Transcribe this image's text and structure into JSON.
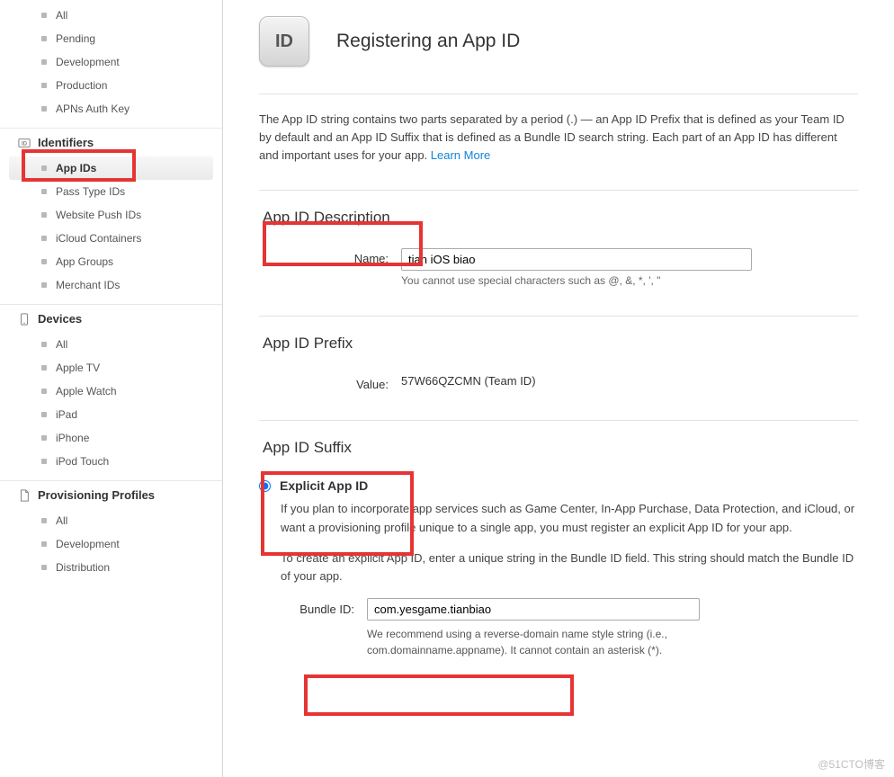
{
  "sidebar": {
    "certificates": {
      "items": [
        "All",
        "Pending",
        "Development",
        "Production",
        "APNs Auth Key"
      ]
    },
    "identifiers": {
      "heading": "Identifiers",
      "items": [
        "App IDs",
        "Pass Type IDs",
        "Website Push IDs",
        "iCloud Containers",
        "App Groups",
        "Merchant IDs"
      ],
      "selected": "App IDs"
    },
    "devices": {
      "heading": "Devices",
      "items": [
        "All",
        "Apple TV",
        "Apple Watch",
        "iPad",
        "iPhone",
        "iPod Touch"
      ]
    },
    "profiles": {
      "heading": "Provisioning Profiles",
      "items": [
        "All",
        "Development",
        "Distribution"
      ]
    }
  },
  "header": {
    "badge": "ID",
    "title": "Registering an App ID"
  },
  "intro": {
    "text": "The App ID string contains two parts separated by a period (.) — an App ID Prefix that is defined as your Team ID by default and an App ID Suffix that is defined as a Bundle ID search string. Each part of an App ID has different and important uses for your app. ",
    "link": "Learn More"
  },
  "desc": {
    "title": "App ID Description",
    "name_label": "Name:",
    "name_value": "tian iOS biao",
    "name_hint": "You cannot use special characters such as @, &, *, ', \""
  },
  "prefix": {
    "title": "App ID Prefix",
    "value_label": "Value:",
    "value": "57W66QZCMN (Team ID)"
  },
  "suffix": {
    "title": "App ID Suffix",
    "explicit_label": "Explicit App ID",
    "explicit_text1": "If you plan to incorporate app services such as Game Center, In-App Purchase, Data Protection, and iCloud, or want a provisioning profile unique to a single app, you must register an explicit App ID for your app.",
    "explicit_text2": "To create an explicit App ID, enter a unique string in the Bundle ID field. This string should match the Bundle ID of your app.",
    "bundle_label": "Bundle ID:",
    "bundle_value": "com.yesgame.tianbiao",
    "bundle_hint": "We recommend using a reverse-domain name style string (i.e., com.domainname.appname). It cannot contain an asterisk (*)."
  },
  "watermark": "@51CTO博客"
}
